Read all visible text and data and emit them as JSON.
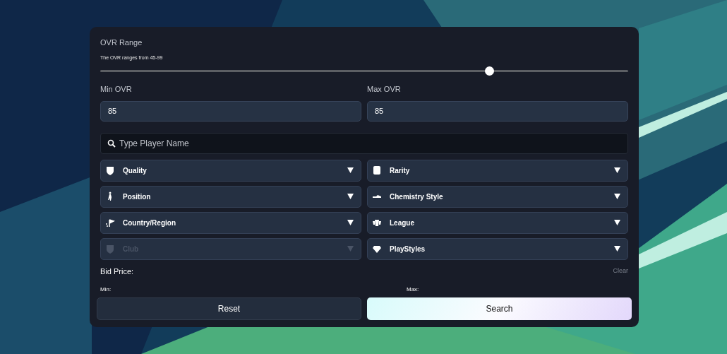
{
  "ovr_range": {
    "label": "OVR Range",
    "hint": "The OVR ranges from 45-99",
    "level": 0.737
  },
  "min_ovr": {
    "label": "Min OVR",
    "value": "85"
  },
  "max_ovr": {
    "label": "Max OVR",
    "value": "85"
  },
  "search": {
    "placeholder": "Type Player Name"
  },
  "filters": [
    {
      "label": "Quality",
      "disabled": false
    },
    {
      "label": "Rarity",
      "disabled": false
    },
    {
      "label": "Position",
      "disabled": false
    },
    {
      "label": "Chemistry Style",
      "disabled": false
    },
    {
      "label": "Country/Region",
      "disabled": false
    },
    {
      "label": "League",
      "disabled": false
    },
    {
      "label": "Club",
      "disabled": true
    },
    {
      "label": "PlayStyles",
      "disabled": false
    }
  ],
  "bid_price": {
    "label": "Bid Price:",
    "clear": "Clear",
    "min_label": "Min:",
    "max_label": "Max:"
  },
  "buttons": {
    "reset": "Reset",
    "search": "Search"
  }
}
